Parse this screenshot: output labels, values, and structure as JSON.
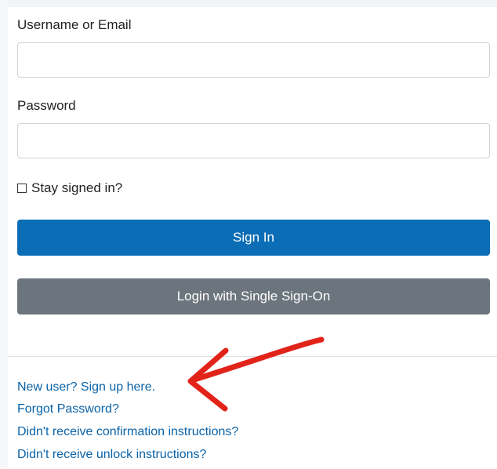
{
  "form": {
    "username_label": "Username or Email",
    "username_value": "",
    "password_label": "Password",
    "password_value": "",
    "stay_signed_in_label": "Stay signed in?",
    "stay_signed_in_checked": false,
    "sign_in_label": "Sign In",
    "sso_label": "Login with Single Sign-On"
  },
  "links": {
    "new_user": "New user? Sign up here.",
    "forgot_password": "Forgot Password?",
    "confirmation": "Didn't receive confirmation instructions?",
    "unlock": "Didn't receive unlock instructions?"
  },
  "colors": {
    "primary_button": "#0b6db5",
    "secondary_button": "#6c757d",
    "link": "#0b63a8",
    "annotation": "#e2231a"
  },
  "annotation": {
    "icon": "red-arrow-icon",
    "target": "new-user-signup-link"
  }
}
